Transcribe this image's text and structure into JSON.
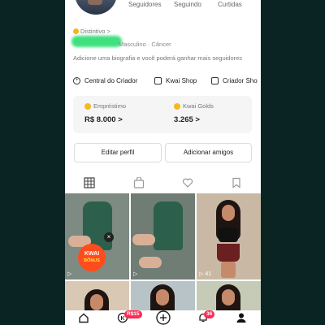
{
  "profile": {
    "stats": [
      "Seguidores",
      "Seguindo",
      "Curtidas"
    ],
    "badge": "Distintivo",
    "badge_chevron": ">",
    "meta": "Masculino · Câncer",
    "bio": "Adicione uma biografia e você poderá ganhar mais seguidores"
  },
  "links": [
    {
      "label": "Central do Criador",
      "icon": "plus-circle-icon"
    },
    {
      "label": "Kwai Shop",
      "icon": "shop-bag-icon"
    },
    {
      "label": "Criador Sho",
      "icon": "store-icon"
    }
  ],
  "wallet": {
    "loan_title": "Empréstimo",
    "loan_value": "R$ 8.000 >",
    "golds_title": "Kwai Golds",
    "golds_value": "3.265 >"
  },
  "buttons": {
    "edit": "Editar perfil",
    "add": "Adicionar amigos"
  },
  "tabs": [
    "grid-icon",
    "lock-bag-icon",
    "heart-icon",
    "bookmark-icon"
  ],
  "promo": {
    "title": "KWAI",
    "subtitle": "BÔNUS"
  },
  "video_counts": {
    "first": "",
    "third": "41"
  },
  "nav": {
    "home_icon": "home-icon",
    "kwai_badge": "R$15",
    "create_icon": "plus-icon",
    "notif_badge": "36",
    "profile_icon": "person-icon"
  },
  "colors": {
    "accent": "#fe2c55",
    "coin": "#f6b81b",
    "name_highlight": "#3fe07f"
  }
}
